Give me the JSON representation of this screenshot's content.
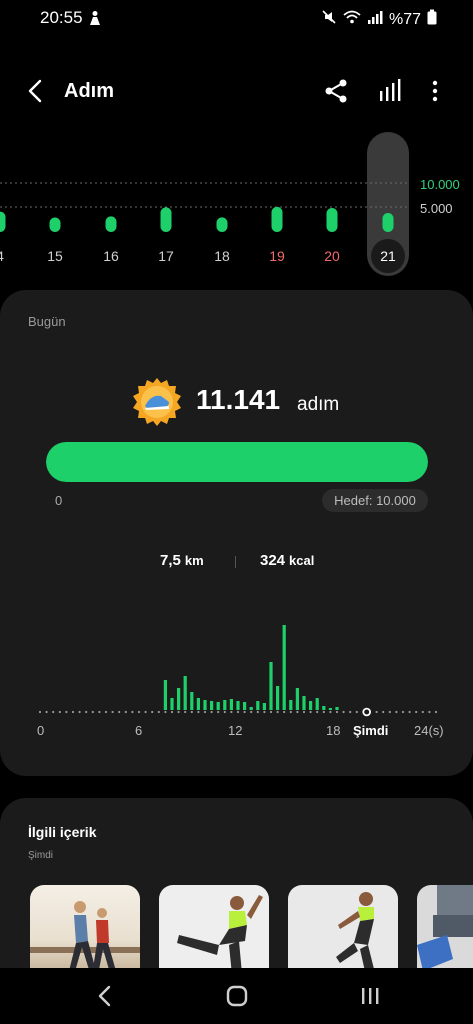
{
  "status": {
    "time": "20:55",
    "battery": "%77",
    "icons": [
      "person-icon",
      "mute-icon",
      "wifi-icon",
      "signal-icon",
      "battery-icon"
    ]
  },
  "header": {
    "title": "Adım",
    "icons": [
      "back-icon",
      "share-icon",
      "bar-chart-icon",
      "more-icon"
    ]
  },
  "week": {
    "days": [
      "4",
      "15",
      "16",
      "17",
      "18",
      "19",
      "20",
      "21"
    ],
    "selected_day": "21",
    "weekend_days": [
      "19",
      "20"
    ],
    "steps": [
      12000,
      8500,
      9200,
      14500,
      8600,
      14800,
      14100,
      11141
    ],
    "ref_high": "10.000",
    "ref_low": "5.000",
    "accent": "#1ed06a"
  },
  "today": {
    "label": "Bugün",
    "badge_icon": "sneaker-badge-icon",
    "steps": "11.141",
    "unit": "adım",
    "progress_fraction": 1.0,
    "progress_start": "0",
    "goal": "Hedef: 10.000",
    "distance_value": "7,5",
    "distance_unit": "km",
    "calories_value": "324",
    "calories_unit": "kcal"
  },
  "hourly": {
    "x_labels": [
      "0",
      "6",
      "12",
      "18",
      "Şimdi",
      "24(s)"
    ],
    "bars": [
      [
        7.6,
        30
      ],
      [
        8.0,
        12
      ],
      [
        8.4,
        22
      ],
      [
        8.8,
        34
      ],
      [
        9.2,
        18
      ],
      [
        9.6,
        12
      ],
      [
        10.0,
        10
      ],
      [
        10.4,
        9
      ],
      [
        10.8,
        8
      ],
      [
        11.2,
        10
      ],
      [
        11.6,
        11
      ],
      [
        12.0,
        9
      ],
      [
        12.4,
        8
      ],
      [
        12.8,
        3
      ],
      [
        13.2,
        9
      ],
      [
        13.6,
        7
      ],
      [
        14.0,
        48
      ],
      [
        14.4,
        24
      ],
      [
        14.8,
        85
      ],
      [
        15.2,
        10
      ],
      [
        15.6,
        22
      ],
      [
        16.0,
        14
      ],
      [
        16.4,
        9
      ],
      [
        16.8,
        12
      ],
      [
        17.2,
        4
      ],
      [
        17.6,
        2
      ],
      [
        18.0,
        3
      ]
    ]
  },
  "related": {
    "title": "İlgili içerik",
    "subtitle": "Şimdi"
  },
  "nav": {
    "icons": [
      "back-nav-icon",
      "home-nav-icon",
      "recents-nav-icon"
    ]
  }
}
